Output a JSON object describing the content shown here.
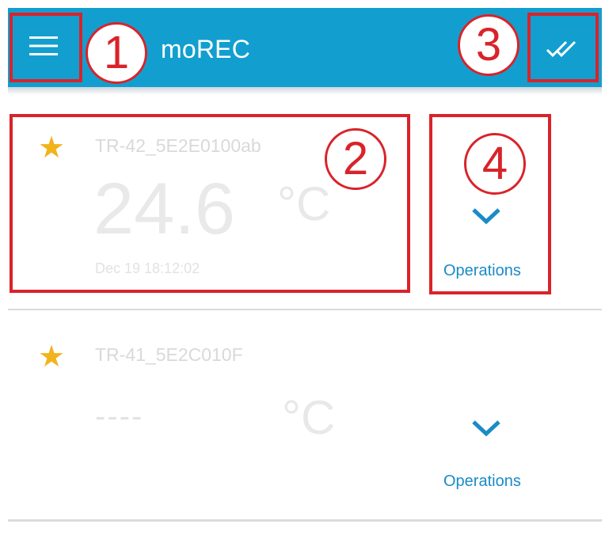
{
  "app": {
    "title": "moREC",
    "accent_color": "#129fcf",
    "menu_icon": "hamburger-menu-icon",
    "select_all_icon": "double-check-icon"
  },
  "devices": [
    {
      "name": "TR-42_5E2E0100ab",
      "temperature": "24.6",
      "unit": "°C",
      "timestamp": "Dec 19 18:12:02",
      "favorite_icon": "star-icon",
      "operations_label": "Operations",
      "operations_icon": "chevron-down-icon"
    },
    {
      "name": "TR-41_5E2C010F",
      "temperature": "----",
      "unit": "°C",
      "timestamp": "",
      "favorite_icon": "star-icon",
      "operations_label": "Operations",
      "operations_icon": "chevron-down-icon"
    }
  ],
  "annotations": {
    "color": "#d9232a",
    "labels": [
      "1",
      "2",
      "3",
      "4"
    ]
  }
}
